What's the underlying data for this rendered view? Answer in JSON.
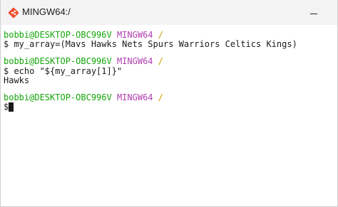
{
  "window": {
    "title": "MINGW64:/",
    "icon": "git-diamond-icon",
    "accent_color": "#f05033"
  },
  "colors": {
    "user": "#14a50a",
    "host": "#b13fb1",
    "path": "#c4a000",
    "text": "#1b1b1b"
  },
  "terminal": {
    "prompt": {
      "user": "bobbi@DESKTOP-OBC996V",
      "shell": "MINGW64",
      "path": "/"
    },
    "commands": [
      {
        "input": "$ my_array=(Mavs Hawks Nets Spurs Warriors Celtics Kings)"
      },
      {
        "input": "$ echo \"${my_array[1]}\"",
        "output": "Hawks"
      }
    ],
    "last_prompt_symbol": "$"
  }
}
